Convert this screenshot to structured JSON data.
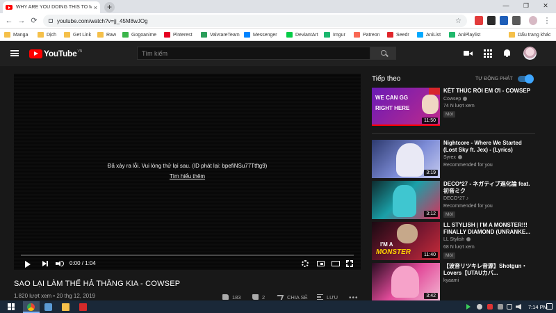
{
  "browser": {
    "tab_title": "WHY ARE YOU DOING THIS TO ME",
    "tab_close": "×",
    "new_tab": "+",
    "url": "youtube.com/watch?v=jj_45M8wJOg",
    "star": "☆",
    "window_controls": [
      "—",
      "❐",
      "✕"
    ],
    "nav": [
      "←",
      "→",
      "⟳"
    ]
  },
  "bookmarks": [
    {
      "label": "Manga",
      "color": "#f5c04a"
    },
    {
      "label": "Dịch",
      "color": "#f5c04a"
    },
    {
      "label": "Get Link",
      "color": "#f5c04a"
    },
    {
      "label": "Raw",
      "color": "#f5c04a"
    },
    {
      "label": "Gogoanime",
      "color": "#3bb54a"
    },
    {
      "label": "Pinterest",
      "color": "#e60023"
    },
    {
      "label": "ValvrareTeam",
      "color": "#2b9e5a"
    },
    {
      "label": "Messenger",
      "color": "#0084ff"
    },
    {
      "label": "DeviantArt",
      "color": "#05cc47"
    },
    {
      "label": "Imgur",
      "color": "#1bb76e"
    },
    {
      "label": "Patreon",
      "color": "#f96854"
    },
    {
      "label": "Seedr",
      "color": "#e0262b"
    },
    {
      "label": "AniList",
      "color": "#02a9ff"
    },
    {
      "label": "AniPlaylist",
      "color": "#1fb86b"
    },
    {
      "label": "Dấu trang khác",
      "color": "#f5c04a"
    }
  ],
  "youtube": {
    "logo_text": "YouTube",
    "logo_region": "VN",
    "search_placeholder": "Tìm kiếm"
  },
  "player": {
    "error_text": "Đã xảy ra lỗi. Vui lòng thử lại sau. (ID phát lại: bpefiNSu77Ttftg9)",
    "error_link": "Tìm hiểu thêm",
    "time": "0:00 / 1:04"
  },
  "video": {
    "title": "SAO LẠI LÀM THẾ HẢ THẰNG KIA - COWSEP",
    "meta": "1.820 lượt xem • 20 thg 12, 2019",
    "likes": "183",
    "dislikes": "2",
    "share": "CHIA SẺ",
    "save": "LƯU",
    "more": "•••"
  },
  "sidebar": {
    "heading": "Tiếp theo",
    "autoplay_label": "TỰ ĐỘNG PHÁT",
    "autoplay_on": true,
    "items": [
      {
        "title": "KẾT THÚC RỒI EM ƠI - COWSEP",
        "channel": "Cowsep",
        "stat": "74 N lượt xem",
        "badge": "Mới",
        "duration": "11:50",
        "thumb_text_1": "WE CAN GG",
        "thumb_text_2": "RIGHT HERE"
      },
      {
        "title": "Nightcore - Where We Started (Lost Sky ft. Jex) - (Lyrics)",
        "channel": "Syrex",
        "stat": "Recommended for you",
        "badge": "",
        "duration": "3:19"
      },
      {
        "title": "DECO*27 - ネガティブ進化論 feat. 初音ミク",
        "channel": "DECO*27 ♪",
        "stat": "Recommended for you",
        "badge": "Mới",
        "duration": "3:12"
      },
      {
        "title": "LL STYLISH | I'M A MONSTER!!! FINALLY DIAMOND (UNRANKE...",
        "channel": "LL Stylish",
        "stat": "68 N lượt xem",
        "badge": "Mới",
        "duration": "11:40",
        "thumb_text_1": "I'M A",
        "thumb_text_2": "MONSTER"
      },
      {
        "title": "【波音リツキレ音源】Shotgun・Lovers【UTAUカバ...",
        "channel": "kyaami",
        "stat": "",
        "badge": "",
        "duration": "3:42"
      }
    ]
  },
  "taskbar": {
    "clock": "7:14 PM"
  },
  "colors": {
    "accent": "#3ea6ff",
    "brand_red": "#ff0000",
    "page_bg": "#181818"
  }
}
